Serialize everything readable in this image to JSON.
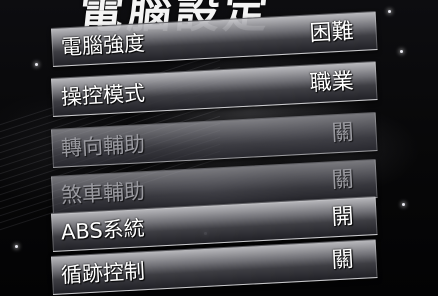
{
  "title": "電腦設定",
  "settings": [
    {
      "label": "電腦強度",
      "value": "困難",
      "enabled": true
    },
    {
      "label": "操控模式",
      "value": "職業",
      "enabled": true
    },
    {
      "label": "轉向輔助",
      "value": "關",
      "enabled": false
    },
    {
      "label": "煞車輔助",
      "value": "關",
      "enabled": false
    },
    {
      "label": "ABS系統",
      "value": "開",
      "enabled": true
    },
    {
      "label": "循跡控制",
      "value": "關",
      "enabled": true
    }
  ]
}
